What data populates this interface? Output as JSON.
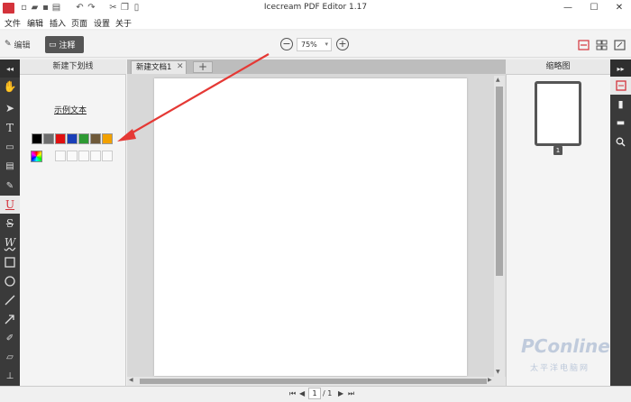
{
  "window": {
    "title": "Icecream PDF Editor 1.17"
  },
  "menu": [
    "文件",
    "编辑",
    "插入",
    "页面",
    "设置",
    "关于"
  ],
  "toolbar": {
    "edit_label": "编辑",
    "annotate_label": "注释",
    "zoom": "75%"
  },
  "left_panel": {
    "header": "新建下划线",
    "sample_text": "示例文本"
  },
  "colors": [
    "#000000",
    "#6e6e6e",
    "#e01010",
    "#1a3fb8",
    "#2e9a33",
    "#6f5a3a",
    "#f2a100"
  ],
  "document": {
    "tab_label": "新建文档1"
  },
  "right_panel": {
    "header": "缩略图",
    "thumb_page_number": "1"
  },
  "status": {
    "current_page": "1",
    "total_pages": "/ 1"
  },
  "watermark": {
    "brand": "PConline",
    "sub": "太平洋电脑网"
  },
  "accent": "#d4333b"
}
